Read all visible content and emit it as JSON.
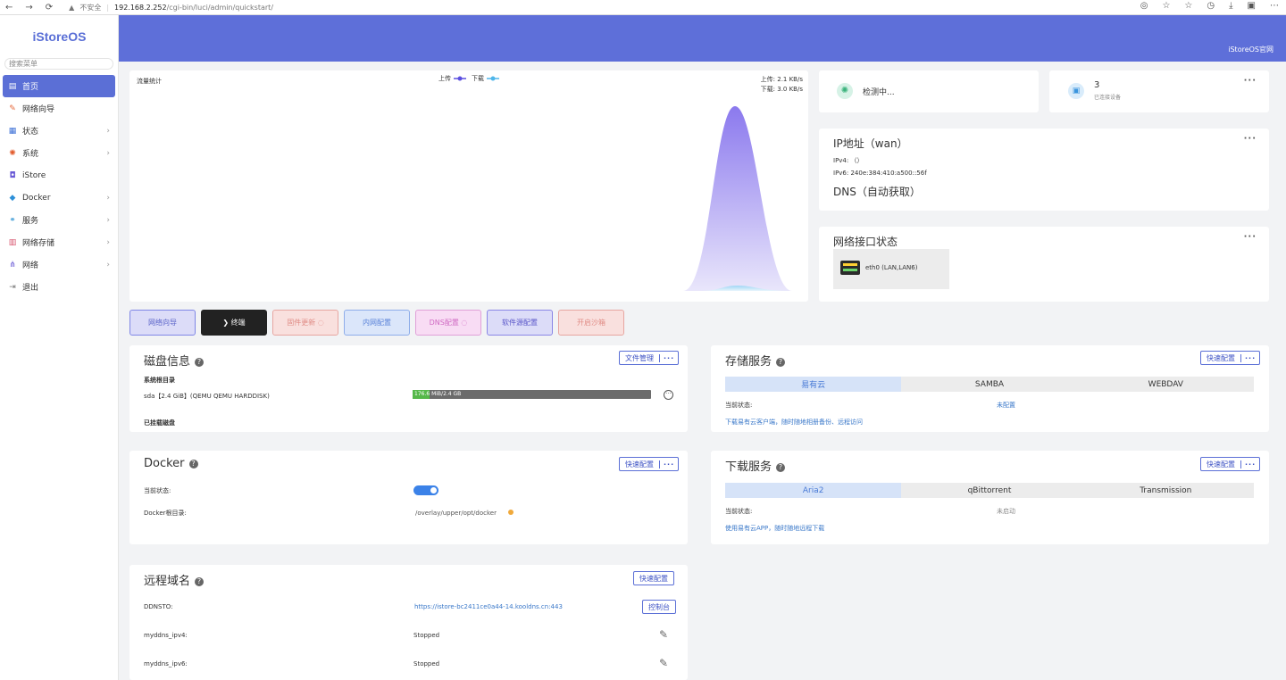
{
  "browser": {
    "nav": [
      "←",
      "→",
      "⟳"
    ],
    "security": "不安全",
    "host": "192.168.2.252",
    "path": "/cgi-bin/luci/admin/quickstart/"
  },
  "sidebar": {
    "logo": "iStoreOS",
    "search_placeholder": "搜索菜单",
    "items": [
      {
        "label": "首页",
        "icon": "home-icon",
        "active": true,
        "chevron": false
      },
      {
        "label": "网络向导",
        "icon": "wizard-icon",
        "chevron": false
      },
      {
        "label": "状态",
        "icon": "status-icon",
        "chevron": true
      },
      {
        "label": "系统",
        "icon": "system-icon",
        "chevron": true
      },
      {
        "label": "iStore",
        "icon": "store-icon",
        "chevron": false
      },
      {
        "label": "Docker",
        "icon": "docker-icon",
        "chevron": true
      },
      {
        "label": "服务",
        "icon": "service-icon",
        "chevron": true
      },
      {
        "label": "网络存储",
        "icon": "storage-icon",
        "chevron": true
      },
      {
        "label": "网络",
        "icon": "network-icon",
        "chevron": true
      },
      {
        "label": "退出",
        "icon": "logout-icon",
        "chevron": false
      }
    ]
  },
  "header": {
    "official": "iStoreOS官网"
  },
  "traffic": {
    "title": "流量统计",
    "legend_up": "上传",
    "legend_down": "下载",
    "up_rate": "上传: 2.1 KB/s",
    "down_rate": "下载: 3.0 KB/s",
    "colors": {
      "up": "#7c6ff0",
      "down": "#4fb6ea"
    }
  },
  "status_cards": {
    "checking": "检测中...",
    "devices_count": "3",
    "devices_label": "已连接设备"
  },
  "ip_card": {
    "title": "IP地址（wan）",
    "ipv4": "IPv4: （）",
    "ipv6": "IPv6: 240e:384:410:a500::56f",
    "dns": "DNS（自动获取）"
  },
  "iface_card": {
    "title": "网络接口状态",
    "iface": "eth0 (LAN,LAN6)"
  },
  "quick_buttons": [
    {
      "label": "网络向导",
      "bg": "#dcdcf8",
      "border": "#7f86e6",
      "color": "#5a63c9"
    },
    {
      "label": "❯ 终端",
      "bg": "#222222",
      "border": "#222222",
      "color": "#ffffff"
    },
    {
      "label": "固件更新 ◌",
      "bg": "#f9e0de",
      "border": "#e7a6a1",
      "color": "#e08b85"
    },
    {
      "label": "内网配置",
      "bg": "#dbe6fa",
      "border": "#8eadea",
      "color": "#5a83d9"
    },
    {
      "label": "DNS配置 ◌",
      "bg": "#f8dcf4",
      "border": "#e0a0d8",
      "color": "#d06ac3"
    },
    {
      "label": "软件源配置",
      "bg": "#dcdcf8",
      "border": "#8a86e6",
      "color": "#5a56c9"
    },
    {
      "label": "开启沙箱",
      "bg": "#f9e0de",
      "border": "#e7a6a1",
      "color": "#e08b85"
    }
  ],
  "disk": {
    "title": "磁盘信息",
    "btn": "文件管理",
    "root_label": "系统根目录",
    "sda": "sda【2.4 GiB】(QEMU QEMU HARDDISK)",
    "usage_text": "176.6 MiB/2.4 GB",
    "usage_fraction": 0.072,
    "mounted_label": "已挂载磁盘"
  },
  "docker": {
    "title": "Docker",
    "btn": "快速配置",
    "status_label": "当前状态:",
    "root_label": "Docker根目录:",
    "root_value": "/overlay/upper/opt/docker",
    "enabled": true
  },
  "ddns": {
    "title": "远程域名",
    "btn": "快速配置",
    "rows": [
      {
        "name": "DDNSTO:",
        "value": "https://istore-bc2411ce0a44-14.kooldns.cn:443",
        "action": "控制台"
      },
      {
        "name": "myddns_ipv4:",
        "value": "Stopped"
      },
      {
        "name": "myddns_ipv6:",
        "value": "Stopped"
      }
    ]
  },
  "storage": {
    "title": "存储服务",
    "btn": "快速配置",
    "tabs": [
      "易有云",
      "SAMBA",
      "WEBDAV"
    ],
    "status_label": "当前状态:",
    "status_value": "未配置",
    "tip": "下载易有云客户端，随时随地相册备份、远程访问"
  },
  "download": {
    "title": "下载服务",
    "btn": "快速配置",
    "tabs": [
      "Aria2",
      "qBittorrent",
      "Transmission"
    ],
    "status_label": "当前状态:",
    "status_value": "未启动",
    "tip": "使用易有云APP，随时随地远程下载"
  }
}
